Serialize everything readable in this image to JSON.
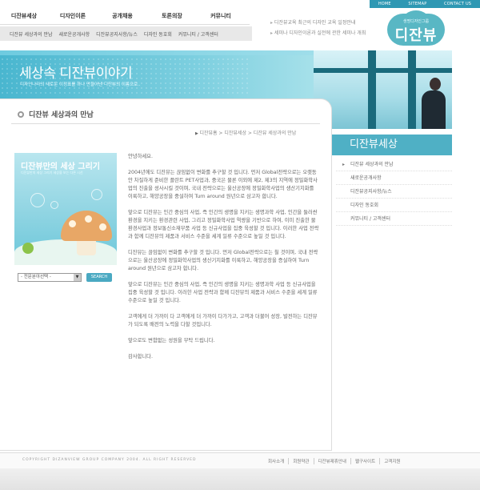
{
  "util_nav": [
    "HOME",
    "SITEMAP",
    "CONTACT US"
  ],
  "main_nav": [
    "디잔뷰세상",
    "디자인이론",
    "공개채용",
    "토론의장",
    "커뮤니티"
  ],
  "sub_nav": [
    "디잔뷰 세상과의 만남",
    "새로운공개사항",
    "디잔뷰공지사항/뉴스",
    "디자인 동호회",
    "커뮤니티 / 고객센터"
  ],
  "notices": [
    "디잔뷰교육 최근의 디자인 교육 일정안내",
    "세미나 디자인이론과 실전에 관한 세미나 개최"
  ],
  "logo": {
    "small": "생명디자인그룹",
    "big": "디잔뷰"
  },
  "hero": {
    "title": "세상속 디잔뷰이야기",
    "subtitle": "디자인나라의 새로운 이정표를 하나 만들어낸 디잔뷰의 이름으로.."
  },
  "section": {
    "title": "디잔뷰 세상과의 만남",
    "breadcrumb": "디잔뷰홈 > 디잔뷰세상 > 디잔뷰 세상과의 만남"
  },
  "book": {
    "title": "디잔뷰만의 세상 그리기",
    "subtitle": "디잔뷰만의 세상 그리기 세상을 보는 다른 시선"
  },
  "search": {
    "select_label": "- 전문분야선택 -",
    "button": "SEARCH"
  },
  "paragraphs": [
    "안녕하세요.",
    "2004년에도 디잔뷰는 끊임없이 변화를 추구할 것 입니다. 먼저 Global전략으로는 오랫동안 차질하게 준비한 플란트 PET사업과, 중국은 물론 이외에 제2, 제3의 지역에 정밀화학사업의 진출을 성사시킬 것이며, 국내 전략으로는 울산공장에 정밀화학사업의 생산기지화를 이룩하고, 해양공장을 중설하여 Turn around 원년으로 삼고자 합니다.",
    "앞으로 디잔뷰는 인간 중심의 사업, 즉 인간의 생명을 지키는 생명과학 사업, 인간을 둘러싼 환경을 지키는 환경관련 사업, 그리고 정밀화학사업 역량을 기반으로 하여, 이미 진출한 물환경사업과 정보통신소재부품 사업 등 신규사업을 집중 육성할 것 입니다. 이러한 사업 전략과 함께 디잔뷰의 제품과 서비스 수준을 세계 일류 수준으로 높일 것 입니다.",
    "디잔뷰는 끊임없이 변화를 추구할 것 입니다. 먼저 Global전략으로는 칠 것이며, 국내 전략으로는 울산공장에 정밀화학사업의 생산기지화를 이룩하고, 해양공장을 증설하여 Turn around 원년으로 삼고자 합니다.",
    "앞으로 디잔뷰는 인간 중심의 사업, 즉 인간의 생명을 지키는 생명과학 사업 등 신규사업을 집중 육성할 것 입니다. 이러한 사업 전략과 함께 디잔뷰의 제품과 서비스 수준을 세계 일류 수준으로 높일 것 입니다.",
    "고객에게 더 가까이 다 고객에게 더 가까이 다가가고, 고객과 더불어 성장, 발전하는 디잔뷰가 되도록 배전의 노력을 다할 것입니다.",
    "앞으로도 변함없는 성원을 부탁 드립니다.",
    "감사합니다."
  ],
  "sidebar": {
    "title": "디잔뷰세상",
    "items": [
      "디잔뷰 세상과의 만남",
      "새로운공개사항",
      "디잔뷰공지사항/뉴스",
      "디자인 동호회",
      "커뮤니티 / 고객센터"
    ]
  },
  "footer": {
    "copyright": "COPYRIGHT DIZANVIEW GROUP COMPANY 2004. ALL RIGHT RESERVED",
    "links": [
      "회사소개",
      "회원약관",
      "디잔뷰제휴안내",
      "웹구사이트",
      "고객지원"
    ]
  },
  "colors": {
    "accent": "#4fb0c5",
    "util_bar": "#2f98b3",
    "link": "#2a8fb3"
  }
}
